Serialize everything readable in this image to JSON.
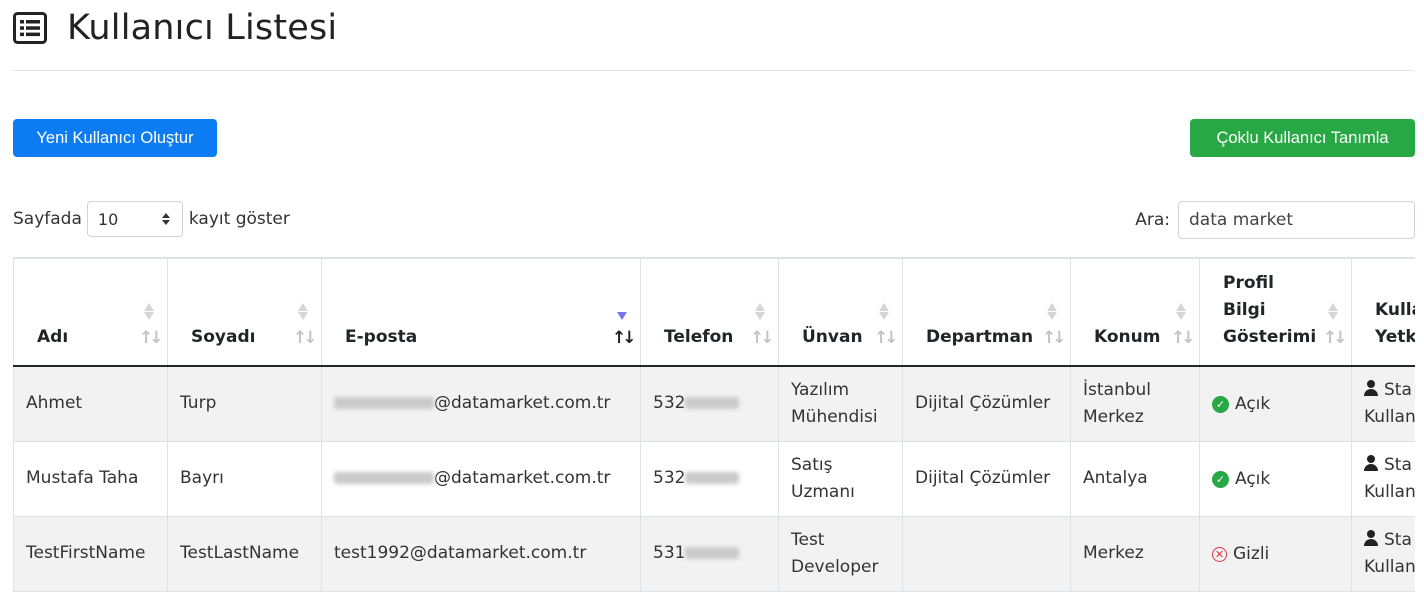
{
  "page": {
    "title": "Kullanıcı Listesi",
    "title_icon": "list-icon"
  },
  "actions": {
    "new_user": "Yeni Kullanıcı Oluştur",
    "bulk_users": "Çoklu Kullanıcı Tanımla"
  },
  "length_control": {
    "prefix": "Sayfada",
    "value": "10",
    "suffix": "kayıt göster"
  },
  "search": {
    "label": "Ara:",
    "value": "data market"
  },
  "table": {
    "headers": [
      {
        "lines": [
          "Adı"
        ]
      },
      {
        "lines": [
          "Soyadı"
        ]
      },
      {
        "lines": [
          "E-posta"
        ]
      },
      {
        "lines": [
          "Telefon"
        ]
      },
      {
        "lines": [
          "Ünvan"
        ]
      },
      {
        "lines": [
          "Departman"
        ]
      },
      {
        "lines": [
          "Konum"
        ]
      },
      {
        "lines": [
          "Profil",
          "Bilgi",
          "Gösterimi"
        ]
      },
      {
        "lines": [
          "Kulla",
          "Yetk"
        ]
      }
    ],
    "rows": [
      {
        "ad": "Ahmet",
        "soyad": "Turp",
        "email_domain": "@datamarket.com.tr",
        "phone_prefix": "532",
        "unvan": [
          "Yazılım",
          "Mühendisi"
        ],
        "departman": "Dijital Çözümler",
        "konum": [
          "İstanbul",
          "Merkez"
        ],
        "profil": "Açık",
        "profil_state": "open",
        "yetki": [
          "Sta",
          "Kullan"
        ]
      },
      {
        "ad": "Mustafa Taha",
        "soyad": "Bayrı",
        "email_domain": "@datamarket.com.tr",
        "phone_prefix": "532",
        "unvan": [
          "Satış",
          "Uzmanı"
        ],
        "departman": "Dijital Çözümler",
        "konum": [
          "Antalya"
        ],
        "profil": "Açık",
        "profil_state": "open",
        "yetki": [
          "Sta",
          "Kullan"
        ]
      },
      {
        "ad": "TestFirstName",
        "soyad": "TestLastName",
        "email_full": "test1992@datamarket.com.tr",
        "phone_prefix": "531",
        "unvan": [
          "Test",
          "Developer"
        ],
        "departman": "",
        "konum": [
          "Merkez"
        ],
        "profil": "Gizli",
        "profil_state": "hidden",
        "yetki": [
          "Sta",
          "Kullan"
        ]
      }
    ]
  },
  "colors": {
    "primary": "#0d7cf2",
    "success": "#28a745",
    "danger": "#dc3545",
    "active_sort": "#7575e8"
  }
}
